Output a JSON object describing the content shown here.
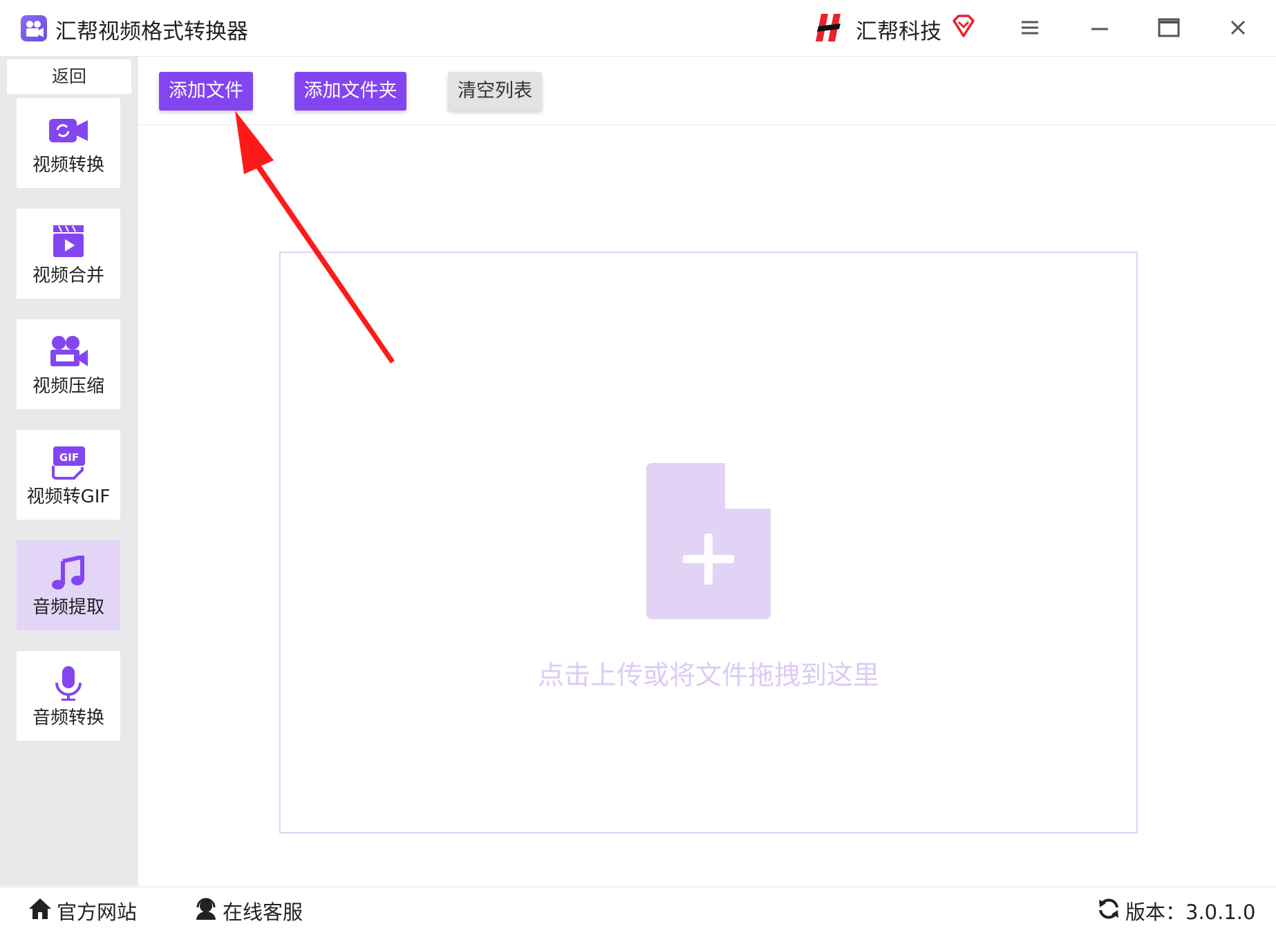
{
  "app": {
    "title": "汇帮视频格式转换器"
  },
  "brand": {
    "name": "汇帮科技"
  },
  "sidebar": {
    "back_label": "返回",
    "items": [
      {
        "label": "视频转换",
        "icon": "video-convert-icon"
      },
      {
        "label": "视频合并",
        "icon": "video-merge-icon"
      },
      {
        "label": "视频压缩",
        "icon": "video-compress-icon"
      },
      {
        "label": "视频转GIF",
        "icon": "gif-icon"
      },
      {
        "label": "音频提取",
        "icon": "music-note-icon",
        "active": true
      },
      {
        "label": "音频转换",
        "icon": "microphone-icon"
      }
    ]
  },
  "toolbar": {
    "add_file": "添加文件",
    "add_folder": "添加文件夹",
    "clear_list": "清空列表"
  },
  "dropzone": {
    "hint": "点击上传或将文件拖拽到这里"
  },
  "statusbar": {
    "website": "官方网站",
    "support": "在线客服",
    "version": "版本：3.0.1.0"
  },
  "colors": {
    "accent": "#8345f0",
    "active_nav_bg": "#e2d5f8",
    "dropzone_border": "#e0d2f7",
    "dropzone_text": "#dccbf5",
    "annotation_arrow": "#ff1a1a"
  }
}
